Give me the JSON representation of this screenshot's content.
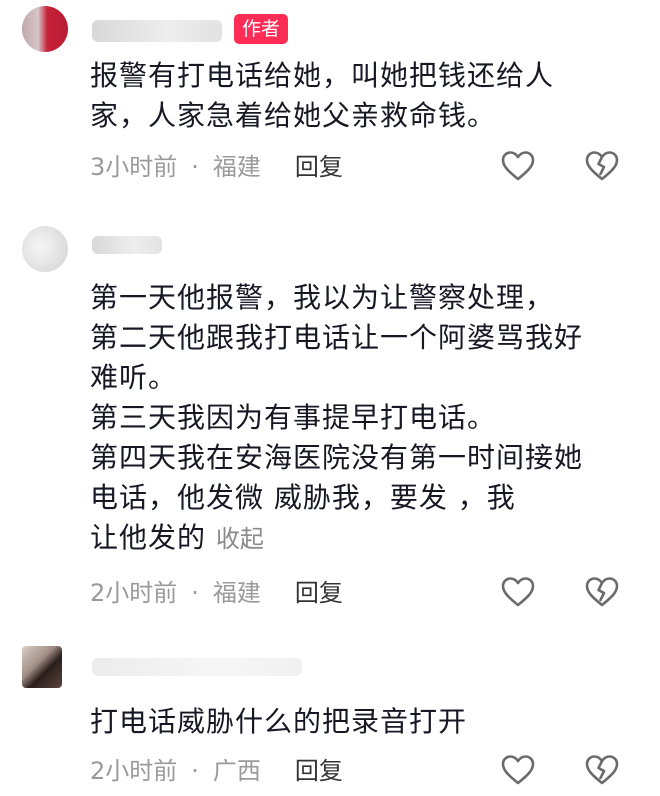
{
  "comments": [
    {
      "tag": "作者",
      "lines": [
        "报警有打电话给她，叫她把钱还给人",
        "家，人家急着给她父亲救命钱。"
      ],
      "time": "3小时前",
      "location": "福建",
      "reply": "回复"
    },
    {
      "lines": [
        "第一天他报警，我以为让警察处理，",
        "第二天他跟我打电话让一个阿婆骂我好",
        "难听。",
        "第三天我因为有事提早打电话。",
        "第四天我在安海医院没有第一时间接她",
        "电话，他发微  威胁我，要发    ，我",
        "让他发的"
      ],
      "collapse": "收起",
      "time": "2小时前",
      "location": "福建",
      "reply": "回复"
    },
    {
      "lines": [
        "打电话威胁什么的把录音打开"
      ],
      "time": "2小时前",
      "location": "广西",
      "reply": "回复"
    }
  ],
  "separator": "·",
  "icons": {
    "like": "heart-outline-icon",
    "dislike": "broken-heart-outline-icon"
  }
}
